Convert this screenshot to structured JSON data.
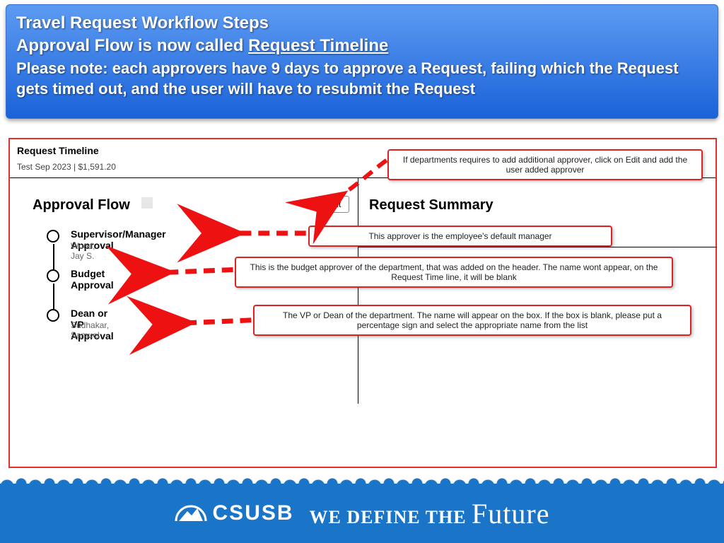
{
  "banner": {
    "line1": "Travel Request Workflow Steps",
    "line2_prefix": "Approval Flow is now called ",
    "line2_ul": "Request Timeline",
    "note": "Please note: each approvers have 9 days to approve a Request, failing which the Request gets timed out, and the user will have to resubmit the Request"
  },
  "request": {
    "timeline_title": "Request Timeline",
    "subline": "Test Sep 2023 | $1,591.20",
    "approval_flow_title": "Approval Flow",
    "edit_label": "Edit",
    "summary_title": "Request Summary",
    "steps": [
      {
        "title": "Supervisor/Manager Approval",
        "name": "Wood, Jay S."
      },
      {
        "title": "Budget Approval",
        "name": ""
      },
      {
        "title": "Dean or VP Approval",
        "name": "Sudhakar, Samuel"
      }
    ]
  },
  "callouts": {
    "edit": "If departments requires to add additional approver, click on Edit and add the user added approver",
    "supervisor": "This approver is the employee's default manager",
    "budget": "This is the budget approver of the department, that was added on the header. The name wont appear, on the Request Time line, it will be blank",
    "dean": "The VP or Dean of the department. The name will appear on the box. If the box is blank, please put a percentage sign and select the appropriate name from the list"
  },
  "footer": {
    "org": "CSUSB",
    "tagline_plain": "WE DEFINE THE",
    "tagline_script": "Future"
  }
}
